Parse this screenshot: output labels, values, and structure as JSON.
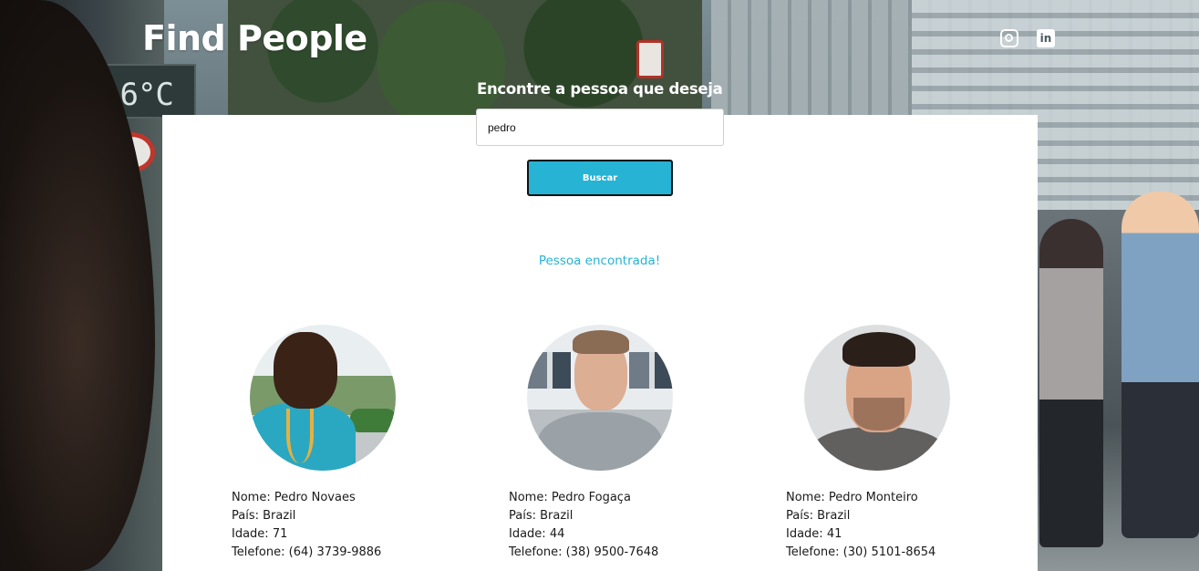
{
  "header": {
    "logo": "Find People",
    "social": [
      {
        "name": "instagram-icon",
        "glyph": ""
      },
      {
        "name": "linkedin-icon",
        "glyph": "in"
      }
    ]
  },
  "background": {
    "sign_text": "16°C"
  },
  "search": {
    "label": "Encontre a pessoa que deseja",
    "value": "pedro",
    "button_label": "Buscar"
  },
  "status": {
    "message": "Pessoa encontrada!",
    "color": "#26b3d4"
  },
  "results": [
    {
      "nome": "Nome: Pedro Novaes",
      "pais": "País: Brazil",
      "idade": "Idade: 71",
      "telefone": "Telefone: (64) 3739-9886"
    },
    {
      "nome": "Nome: Pedro Fogaça",
      "pais": "País: Brazil",
      "idade": "Idade: 44",
      "telefone": "Telefone: (38) 9500-7648"
    },
    {
      "nome": "Nome: Pedro Monteiro",
      "pais": "País: Brazil",
      "idade": "Idade: 41",
      "telefone": "Telefone: (30) 5101-8654"
    }
  ],
  "colors": {
    "accent": "#26b3d4",
    "panel": "#ffffff",
    "text": "#1a1a1a"
  }
}
